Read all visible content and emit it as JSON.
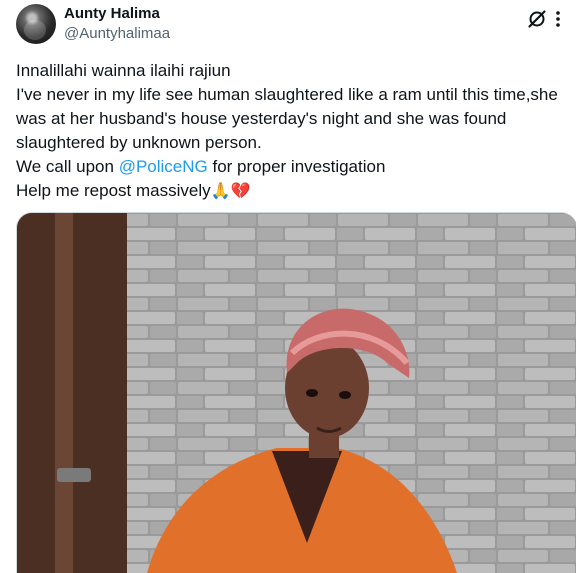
{
  "user": {
    "display_name": "Aunty Halima",
    "handle": "@Auntyhalimaa"
  },
  "icons": {
    "grok": "grok-icon",
    "more": "more-options-icon"
  },
  "tweet": {
    "line1": "Innalillahi wainna ilaihi rajiun",
    "line2": "I've never in my life see human slaughtered like a ram until this time,she",
    "line3": "was at her husband's house yesterday's night and she was found",
    "line4": "slaughtered by unknown person.",
    "line5_prefix": "We call upon ",
    "mention": "@PoliceNG",
    "line5_suffix": " for proper investigation",
    "line6": "Help me repost massively",
    "emoji_pray": "🙏",
    "emoji_broken_heart": "💔"
  },
  "colors": {
    "text": "#0f1419",
    "secondary": "#536471",
    "link": "#1d9bf0"
  }
}
